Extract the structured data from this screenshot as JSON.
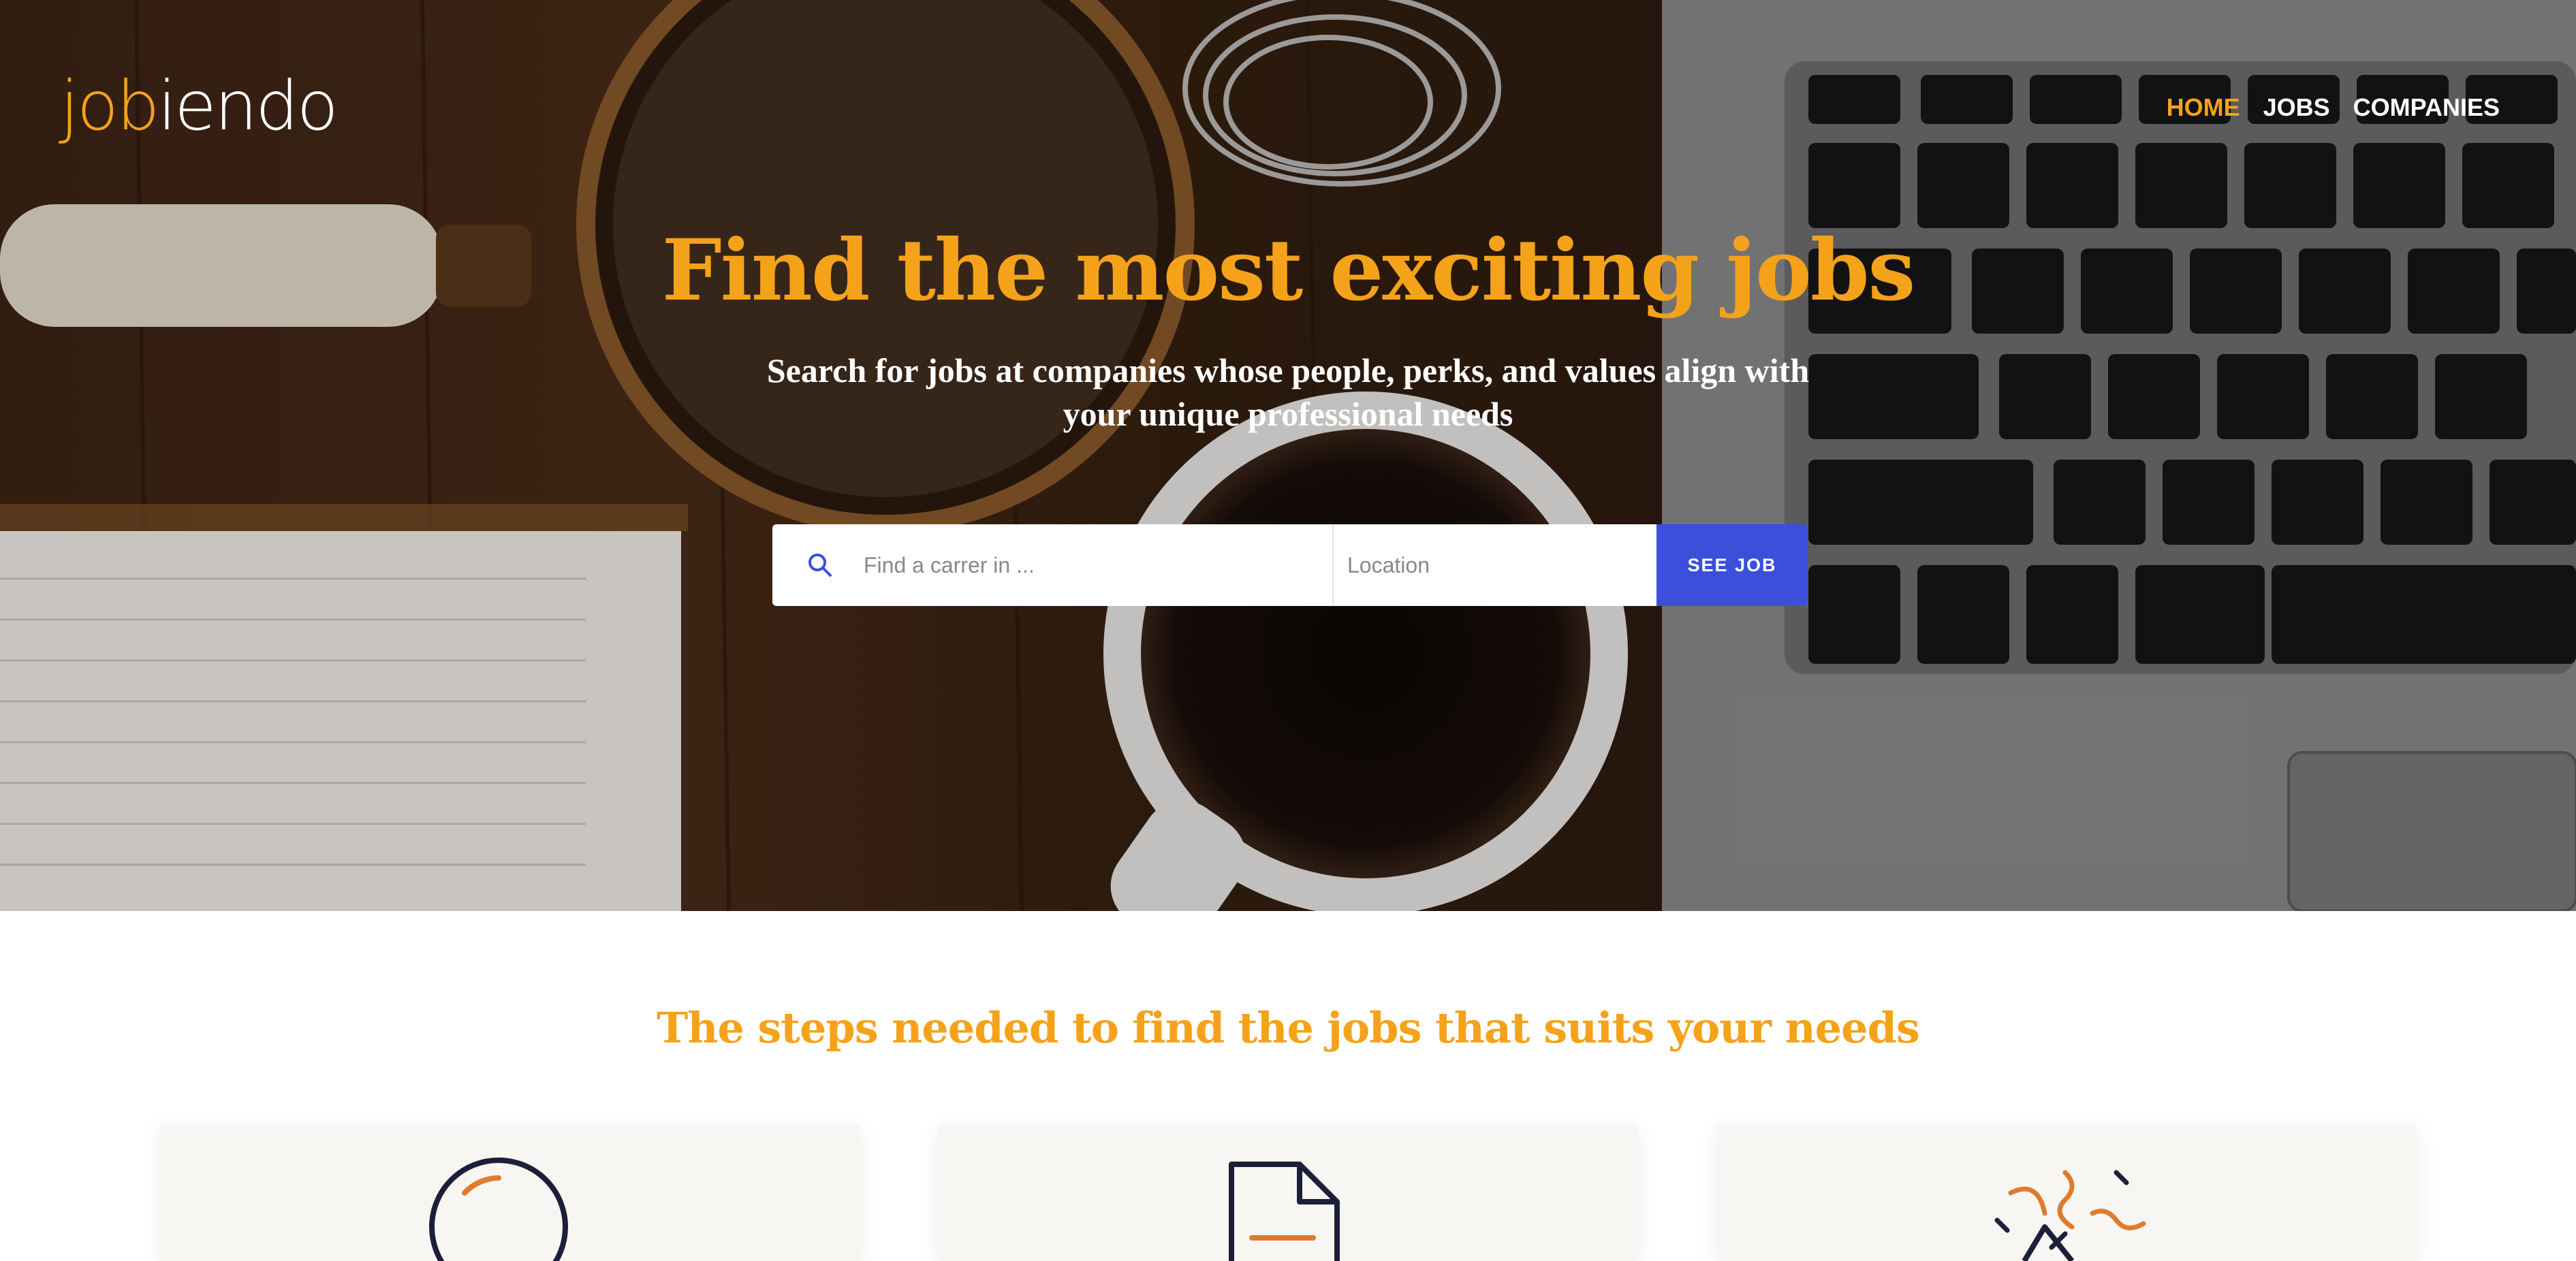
{
  "logo": {
    "part1": "job",
    "part2": "iendo"
  },
  "nav": {
    "home": "HOME",
    "jobs": "JOBS",
    "companies": "COMPANIES"
  },
  "hero": {
    "title": "Find the most exciting jobs",
    "subtitle": "Search for jobs at companies whose people, perks, and values align with your unique professional needs"
  },
  "search": {
    "query_placeholder": "Find a carrer in ...",
    "location_placeholder": "Location",
    "button_label": "SEE JOB"
  },
  "steps": {
    "title": "The steps needed to find the jobs that suits your needs",
    "cards": [
      {
        "icon": "magnifier-icon"
      },
      {
        "icon": "document-icon"
      },
      {
        "icon": "celebration-icon"
      }
    ]
  },
  "colors": {
    "accent": "#f5a21b",
    "primary_button": "#3b4fdb",
    "card_bg": "#f7f6f3"
  }
}
